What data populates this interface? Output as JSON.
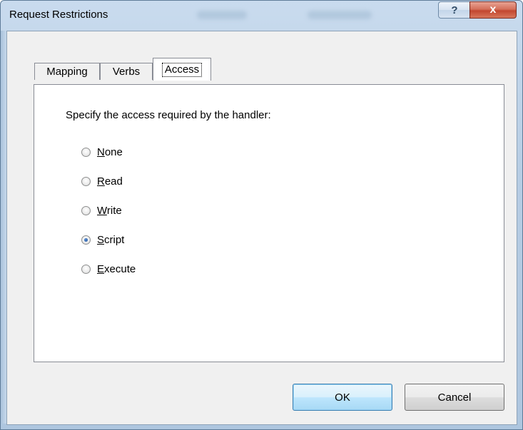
{
  "window": {
    "title": "Request Restrictions",
    "help_glyph": "?",
    "close_glyph": "x"
  },
  "tabs": [
    {
      "label": "Mapping",
      "active": false
    },
    {
      "label": "Verbs",
      "active": false
    },
    {
      "label": "Access",
      "active": true
    }
  ],
  "panel": {
    "prompt": "Specify the access required by the handler:",
    "options": [
      {
        "mnemonic": "N",
        "rest": "one",
        "checked": false
      },
      {
        "mnemonic": "R",
        "rest": "ead",
        "checked": false
      },
      {
        "mnemonic": "W",
        "rest": "rite",
        "checked": false
      },
      {
        "mnemonic": "S",
        "rest": "cript",
        "checked": true
      },
      {
        "mnemonic": "E",
        "rest": "xecute",
        "checked": false
      }
    ]
  },
  "buttons": {
    "ok": "OK",
    "cancel": "Cancel"
  }
}
